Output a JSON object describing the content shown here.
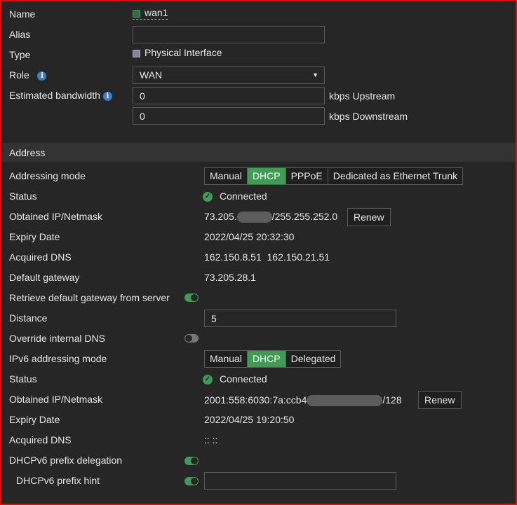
{
  "top": {
    "name_label": "Name",
    "name_value": "wan1",
    "alias_label": "Alias",
    "alias_value": "",
    "type_label": "Type",
    "type_value": "Physical Interface",
    "role_label": "Role",
    "role_value": "WAN",
    "bandwidth_label": "Estimated bandwidth",
    "upstream_value": "0",
    "upstream_unit": "kbps Upstream",
    "downstream_value": "0",
    "downstream_unit": "kbps Downstream"
  },
  "address": {
    "section_title": "Address",
    "mode_label": "Addressing mode",
    "modes": [
      "Manual",
      "DHCP",
      "PPPoE",
      "Dedicated as Ethernet Trunk"
    ],
    "selected_mode": "DHCP",
    "status_label": "Status",
    "status_value": "Connected",
    "ip_label": "Obtained IP/Netmask",
    "ip_prefix": "73.205.",
    "ip_suffix": "/255.255.252.0",
    "renew": "Renew",
    "expiry_label": "Expiry Date",
    "expiry_value": "2022/04/25 20:32:30",
    "dns_label": "Acquired DNS",
    "dns_value": "162.150.8.51  162.150.21.51",
    "gateway_label": "Default gateway",
    "gateway_value": "73.205.28.1",
    "retrieve_label": "Retrieve default gateway from server",
    "distance_label": "Distance",
    "distance_value": "5",
    "override_label": "Override internal DNS",
    "ipv6_mode_label": "IPv6 addressing mode",
    "ipv6_modes": [
      "Manual",
      "DHCP",
      "Delegated"
    ],
    "ipv6_status_label": "Status",
    "ipv6_status_value": "Connected",
    "ipv6_ip_label": "Obtained IP/Netmask",
    "ipv6_ip_prefix": "2001:558:6030:7a:ccb4",
    "ipv6_ip_suffix": "/128",
    "ipv6_renew": "Renew",
    "ipv6_expiry_label": "Expiry Date",
    "ipv6_expiry_value": "2022/04/25 19:20:50",
    "ipv6_dns_label": "Acquired DNS",
    "ipv6_dns_value": ":: ::",
    "pd_label": "DHCPv6 prefix delegation",
    "hint_label": "DHCPv6 prefix hint",
    "hint_value": ""
  },
  "colors": {
    "accent": "#3f9c55",
    "info": "#3d7fc1",
    "border": "#ff0000"
  }
}
